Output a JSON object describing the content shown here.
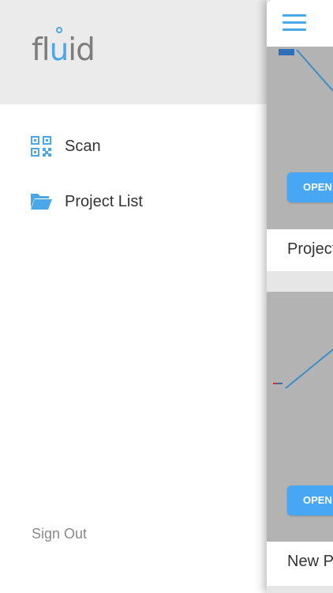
{
  "drawer": {
    "logo": {
      "part1": "fl",
      "part2": "u",
      "part3": "id"
    },
    "items": [
      {
        "label": "Scan",
        "icon": "qr-code-icon"
      },
      {
        "label": "Project List",
        "icon": "folder-open-icon"
      }
    ],
    "sign_out_label": "Sign Out"
  },
  "main": {
    "menu_icon": "hamburger-menu-icon",
    "projects": [
      {
        "button_label": "OPEN",
        "title": "Project"
      },
      {
        "button_label": "OPEN",
        "title": "New P"
      }
    ]
  },
  "colors": {
    "accent": "#47a7f5",
    "header_bg": "#ebebeb",
    "thumbnail_bg": "#b3b3b3"
  }
}
